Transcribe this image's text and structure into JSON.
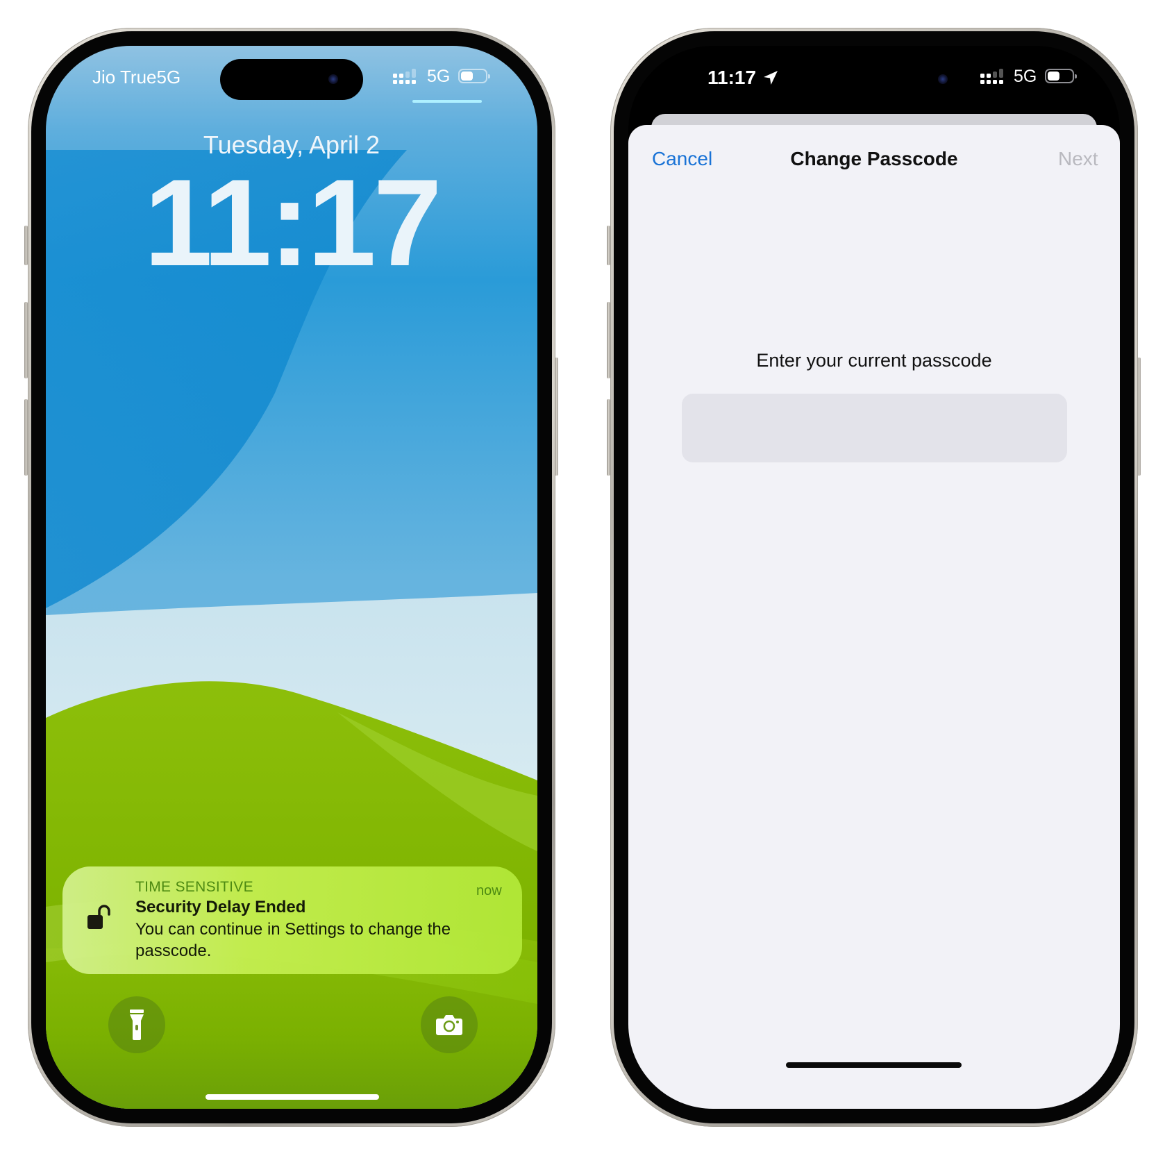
{
  "left_phone": {
    "status_bar": {
      "carrier": "Jio True5G",
      "network": "5G",
      "battery_level": 0.5,
      "signal_bars_strong": 2,
      "signal_bars_total": 4,
      "icons": [
        "signal-icon",
        "battery-icon"
      ]
    },
    "lock_screen": {
      "date": "Tuesday, April 2",
      "time": "11:17"
    },
    "notification": {
      "category": "TIME SENSITIVE",
      "title": "Security Delay Ended",
      "body": "You can continue in Settings to change the passcode.",
      "timestamp": "now",
      "icon": "unlock-icon"
    },
    "quick_actions": [
      {
        "name": "flashlight",
        "icon": "flashlight-icon"
      },
      {
        "name": "camera",
        "icon": "camera-icon"
      }
    ]
  },
  "right_phone": {
    "status_bar": {
      "time": "11:17",
      "network": "5G",
      "battery_level": 0.5,
      "signal_bars_strong": 2,
      "signal_bars_total": 4,
      "icons": [
        "location-arrow-icon",
        "signal-icon",
        "battery-icon"
      ]
    },
    "sheet": {
      "cancel_label": "Cancel",
      "title": "Change Passcode",
      "next_label": "Next",
      "prompt": "Enter your current passcode",
      "passcode_value": ""
    }
  },
  "colors": {
    "ios_blue": "#1a73d6",
    "disabled_gray": "#b9b9bf",
    "sheet_bg": "#f2f2f7",
    "field_bg": "#e3e3ea",
    "notif_category": "#4d8a12"
  }
}
